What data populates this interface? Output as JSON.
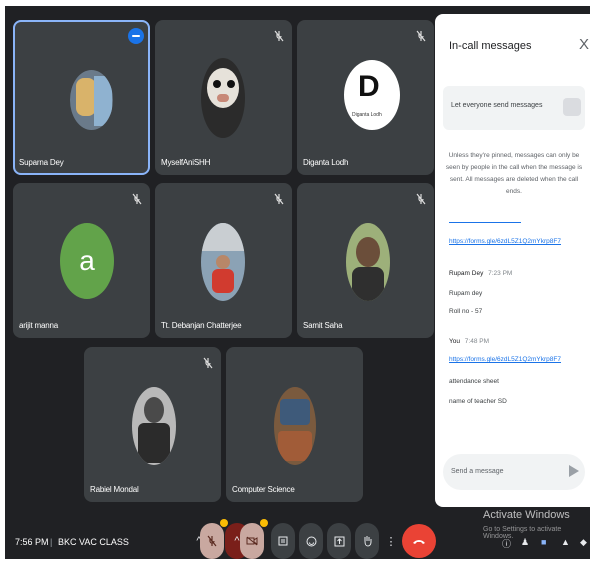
{
  "tiles": [
    {
      "id": "t1",
      "name": "Suparna Dey",
      "active": true,
      "muted": false
    },
    {
      "id": "t2",
      "name": "MyselfAniSHH",
      "muted": true
    },
    {
      "id": "t3",
      "name": "Diganta Lodh",
      "muted": true
    },
    {
      "id": "t4",
      "name": "arijit manna",
      "muted": true,
      "initial": "a"
    },
    {
      "id": "t5",
      "name": "Tt. Debanjan Chatterjee",
      "muted": true
    },
    {
      "id": "t6",
      "name": "Samit Saha",
      "muted": true
    },
    {
      "id": "t7",
      "name": "Rabiel Mondal",
      "muted": true
    },
    {
      "id": "t8",
      "name": "Computer Science",
      "muted": false
    }
  ],
  "logo": {
    "letter": "D",
    "caption": "Diganta Lodh"
  },
  "chat": {
    "title": "In-call messages",
    "close": "X",
    "toggle_label": "Let everyone send messages",
    "notice": "Unless they're pinned, messages can only be seen by people in the call when the message is sent. All messages are deleted when the call ends.",
    "messages": [
      {
        "link": "https://forms.gle/6zdL5Z1Q2mYkrp8F7"
      },
      {
        "sender": "Rupam Dey",
        "time": "7:23 PM",
        "lines": [
          "Rupam dey",
          "Roll no - 57"
        ]
      },
      {
        "sender": "You",
        "time": "7:48 PM",
        "link": "https://forms.gle/6zdL5Z1Q2mYkrp8F7",
        "lines": [
          "attendance sheet",
          "name of teacher SD"
        ]
      }
    ],
    "input_placeholder": "Send a message"
  },
  "bottom": {
    "time": "7:56 PM",
    "separator": "|",
    "meeting": "BKC VAC CLASS"
  },
  "watermark": {
    "title": "Activate Windows",
    "subtitle": "Go to Settings to activate Windows."
  },
  "icons": {
    "mic": "mic-off-icon",
    "cam": "camera-off-icon",
    "cc": "captions-icon",
    "emoji": "emoji-icon",
    "present": "present-icon",
    "hand": "raise-hand-icon",
    "more": "more-vert-icon",
    "end": "call-end-icon"
  }
}
